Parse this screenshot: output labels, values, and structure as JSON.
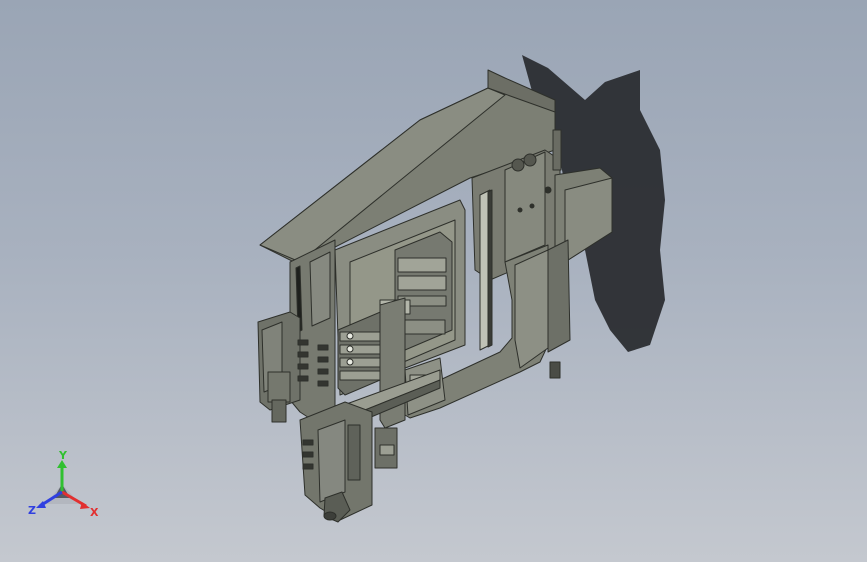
{
  "viewport": {
    "background_top": "#9aa5b5",
    "background_bottom": "#c4c8cf",
    "model_color": "#74766c",
    "model_shadow": "#2a2c30"
  },
  "triad": {
    "x_label": "X",
    "y_label": "Y",
    "z_label": "Z",
    "x_color": "#e23030",
    "y_color": "#30c030",
    "z_color": "#3040e0"
  }
}
